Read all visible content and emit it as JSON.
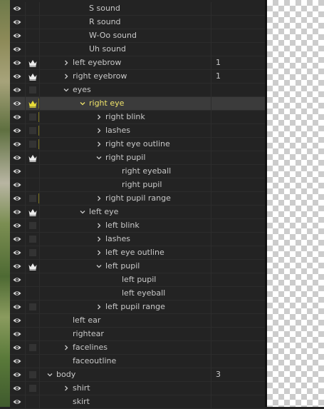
{
  "colors": {
    "panel_bg": "#232323",
    "selected_row_bg": "#3b3b3b",
    "selected_text": "#f0e46a",
    "text": "#c9c9c9",
    "eye_icon": "#d6d6d6",
    "crown_icon": "#ececec",
    "selected_crown_icon": "#e8dc38"
  },
  "layers": [
    {
      "name": "S sound",
      "depth": 3,
      "chevron": "none",
      "crown": false,
      "box": false,
      "tag": false,
      "value": "",
      "selected": false
    },
    {
      "name": "R sound",
      "depth": 3,
      "chevron": "none",
      "crown": false,
      "box": false,
      "tag": false,
      "value": "",
      "selected": false
    },
    {
      "name": "W-Oo sound",
      "depth": 3,
      "chevron": "none",
      "crown": false,
      "box": false,
      "tag": false,
      "value": "",
      "selected": false
    },
    {
      "name": "Uh sound",
      "depth": 3,
      "chevron": "none",
      "crown": false,
      "box": false,
      "tag": false,
      "value": "",
      "selected": false
    },
    {
      "name": "left eyebrow",
      "depth": 2,
      "chevron": "right",
      "crown": true,
      "box": false,
      "tag": false,
      "value": "1",
      "selected": false
    },
    {
      "name": "right eyebrow",
      "depth": 2,
      "chevron": "right",
      "crown": true,
      "box": false,
      "tag": false,
      "value": "1",
      "selected": false
    },
    {
      "name": "eyes",
      "depth": 2,
      "chevron": "down",
      "crown": false,
      "box": true,
      "tag": false,
      "value": "",
      "selected": false
    },
    {
      "name": "right eye",
      "depth": 3,
      "chevron": "down",
      "crown": true,
      "box": false,
      "tag": true,
      "value": "",
      "selected": true
    },
    {
      "name": "right blink",
      "depth": 4,
      "chevron": "right",
      "crown": false,
      "box": true,
      "tag": true,
      "value": "",
      "selected": false
    },
    {
      "name": "lashes",
      "depth": 4,
      "chevron": "right",
      "crown": false,
      "box": true,
      "tag": true,
      "value": "",
      "selected": false
    },
    {
      "name": "right eye outline",
      "depth": 4,
      "chevron": "right",
      "crown": false,
      "box": true,
      "tag": true,
      "value": "",
      "selected": false
    },
    {
      "name": "right pupil",
      "depth": 4,
      "chevron": "down",
      "crown": true,
      "box": false,
      "tag": false,
      "value": "",
      "selected": false
    },
    {
      "name": "right eyeball",
      "depth": 5,
      "chevron": "none",
      "crown": false,
      "box": false,
      "tag": false,
      "value": "",
      "selected": false
    },
    {
      "name": "right pupil",
      "depth": 5,
      "chevron": "none",
      "crown": false,
      "box": false,
      "tag": false,
      "value": "",
      "selected": false
    },
    {
      "name": "right pupil range",
      "depth": 4,
      "chevron": "right",
      "crown": false,
      "box": true,
      "tag": true,
      "value": "",
      "selected": false
    },
    {
      "name": "left eye",
      "depth": 3,
      "chevron": "down",
      "crown": true,
      "box": false,
      "tag": false,
      "value": "",
      "selected": false
    },
    {
      "name": "left blink",
      "depth": 4,
      "chevron": "right",
      "crown": false,
      "box": true,
      "tag": false,
      "value": "",
      "selected": false
    },
    {
      "name": "lashes",
      "depth": 4,
      "chevron": "right",
      "crown": false,
      "box": true,
      "tag": false,
      "value": "",
      "selected": false
    },
    {
      "name": "left eye outline",
      "depth": 4,
      "chevron": "right",
      "crown": false,
      "box": true,
      "tag": false,
      "value": "",
      "selected": false
    },
    {
      "name": "left pupil",
      "depth": 4,
      "chevron": "down",
      "crown": true,
      "box": false,
      "tag": false,
      "value": "",
      "selected": false
    },
    {
      "name": "left pupil",
      "depth": 5,
      "chevron": "none",
      "crown": false,
      "box": false,
      "tag": false,
      "value": "",
      "selected": false
    },
    {
      "name": "left eyeball",
      "depth": 5,
      "chevron": "none",
      "crown": false,
      "box": false,
      "tag": false,
      "value": "",
      "selected": false
    },
    {
      "name": "left pupil range",
      "depth": 4,
      "chevron": "right",
      "crown": false,
      "box": true,
      "tag": false,
      "value": "",
      "selected": false
    },
    {
      "name": "left ear",
      "depth": 2,
      "chevron": "none",
      "crown": false,
      "box": false,
      "tag": false,
      "value": "",
      "selected": false
    },
    {
      "name": "rightear",
      "depth": 2,
      "chevron": "none",
      "crown": false,
      "box": false,
      "tag": false,
      "value": "",
      "selected": false
    },
    {
      "name": "facelines",
      "depth": 2,
      "chevron": "right",
      "crown": false,
      "box": true,
      "tag": false,
      "value": "",
      "selected": false
    },
    {
      "name": "faceoutline",
      "depth": 2,
      "chevron": "none",
      "crown": false,
      "box": false,
      "tag": false,
      "value": "",
      "selected": false
    },
    {
      "name": "body",
      "depth": 1,
      "chevron": "down",
      "crown": false,
      "box": true,
      "tag": false,
      "value": "3",
      "selected": false
    },
    {
      "name": "shirt",
      "depth": 2,
      "chevron": "right",
      "crown": false,
      "box": true,
      "tag": false,
      "value": "",
      "selected": false
    },
    {
      "name": "skirt",
      "depth": 2,
      "chevron": "none",
      "crown": false,
      "box": false,
      "tag": false,
      "value": "",
      "selected": false
    }
  ]
}
